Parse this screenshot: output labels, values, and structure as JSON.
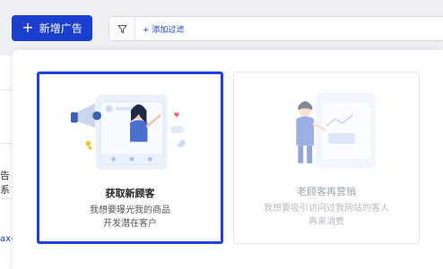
{
  "toolbar": {
    "add_ad_label": "新增广告",
    "add_filter_label": "+ 添加过滤"
  },
  "background": {
    "left_text_1": "告系",
    "left_text_2": "ax-"
  },
  "cards": [
    {
      "title": "获取新顾客",
      "desc_line1": "我想要曝光我的商品",
      "desc_line2": "开发潜在客户",
      "selected": true
    },
    {
      "title": "老顾客再营销",
      "desc_line1": "我想要吸引访问过我网站的客人",
      "desc_line2": "再来消费",
      "selected": false
    }
  ],
  "colors": {
    "primary": "#1a3fcf",
    "selected_border": "#1c3fe0"
  },
  "icons": [
    "plus-icon",
    "filter-icon",
    "megaphone-illustration",
    "chart-illustration"
  ]
}
